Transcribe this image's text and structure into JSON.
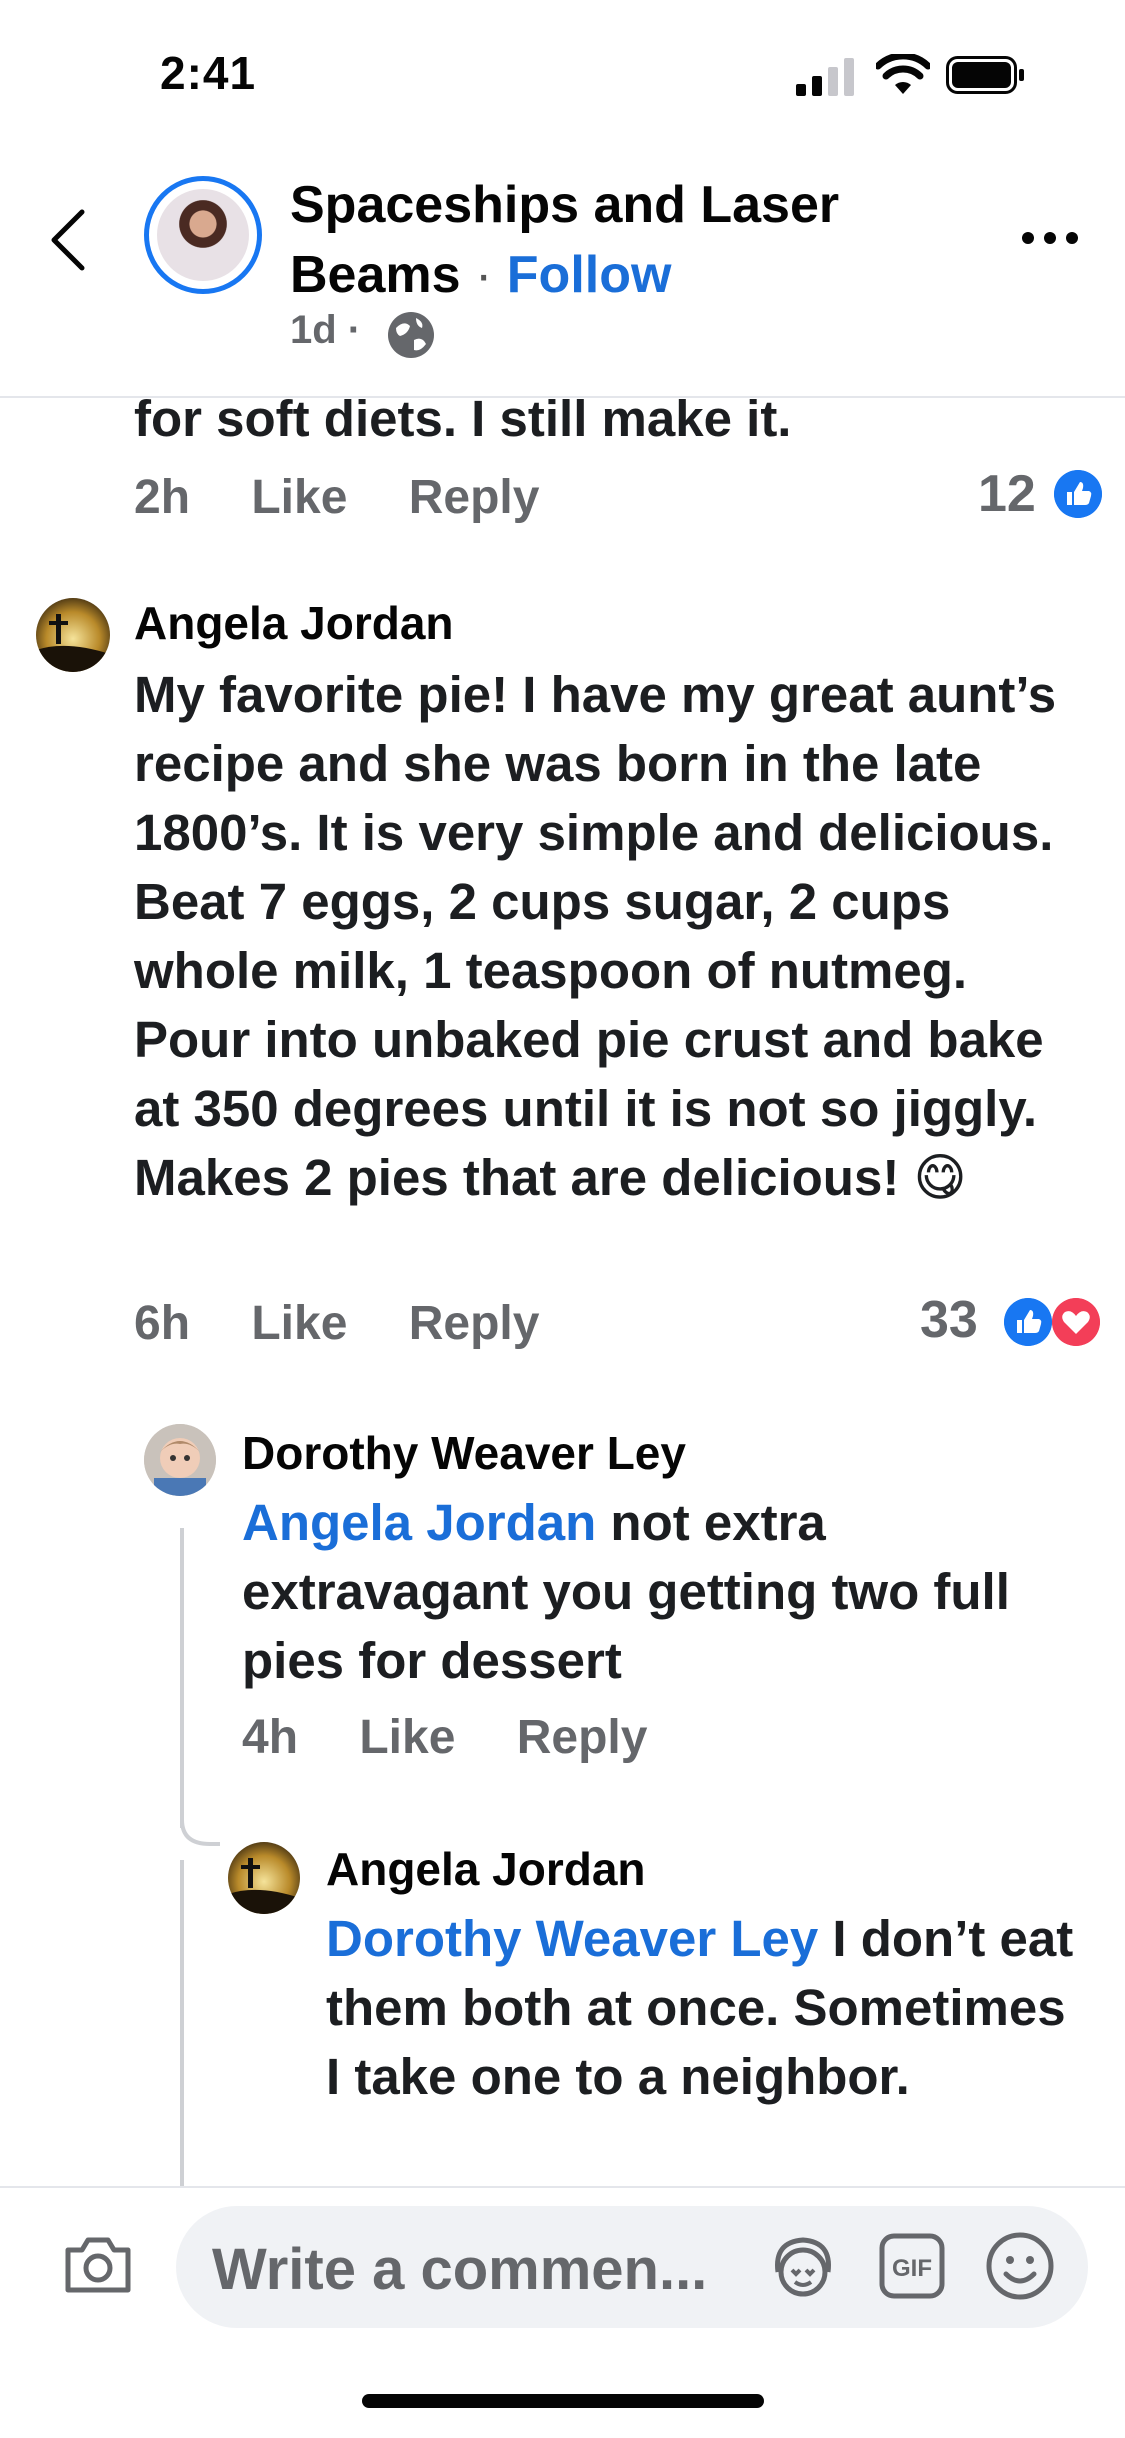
{
  "status_bar": {
    "time": "2:41"
  },
  "header": {
    "page_name": "Spaceships and Laser Beams",
    "separator": "·",
    "follow_label": "Follow",
    "post_age": "1d ·"
  },
  "comments": [
    {
      "partial_text": "for soft diets. I still make it.",
      "time": "2h",
      "like_label": "Like",
      "reply_label": "Reply",
      "reaction_count": "12"
    },
    {
      "author": "Angela Jordan",
      "text": "My favorite pie! I have my great aunt’s recipe and she was born in the late 1800’s. It is very simple and delicious. Beat 7 eggs, 2 cups sugar, 2 cups whole milk, 1 teaspoon of nutmeg. Pour into unbaked pie crust and bake at 350 degrees until it is not so jiggly. Makes 2 pies that are delicious! 😋",
      "time": "6h",
      "like_label": "Like",
      "reply_label": "Reply",
      "reaction_count": "33"
    }
  ],
  "replies": [
    {
      "author": "Dorothy Weaver Ley",
      "mention": "Angela Jordan",
      "text": " not extra extravagant you getting two full pies for dessert",
      "time": "4h",
      "like_label": "Like",
      "reply_label": "Reply"
    },
    {
      "author": "Angela Jordan",
      "mention": "Dorothy Weaver Ley",
      "text": " I don’t eat them both at once. Sometimes I take one to a neighbor."
    }
  ],
  "composer": {
    "placeholder": "Write a commen..."
  },
  "colors": {
    "accent": "#1877f2",
    "mention": "#1a6ed8",
    "love": "#f33e58",
    "muted": "#65676b"
  }
}
